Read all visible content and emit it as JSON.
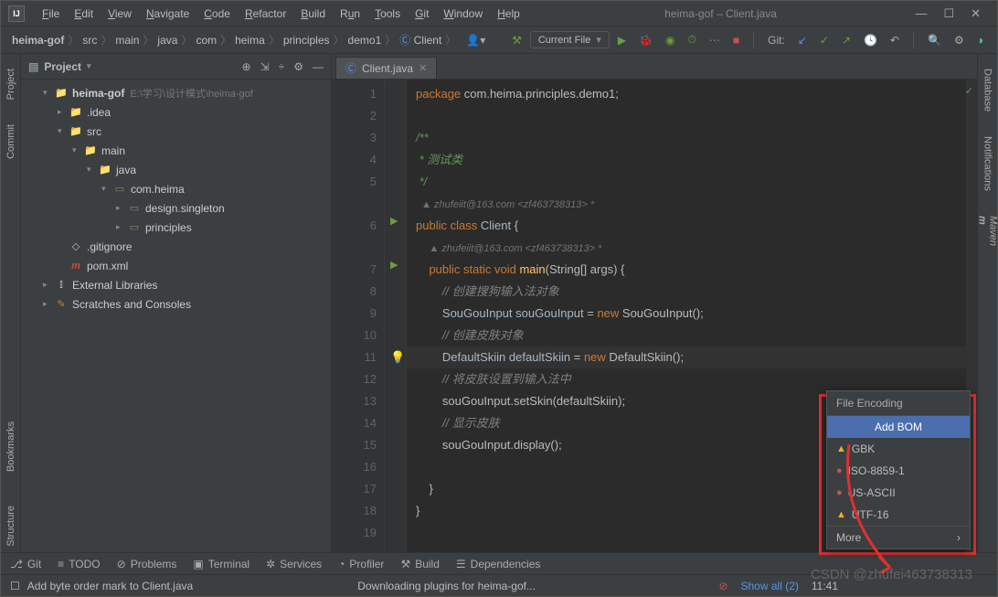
{
  "window_title": "heima-gof – Client.java",
  "menu": [
    "File",
    "Edit",
    "View",
    "Navigate",
    "Code",
    "Refactor",
    "Build",
    "Run",
    "Tools",
    "Git",
    "Window",
    "Help"
  ],
  "breadcrumbs": [
    "heima-gof",
    "src",
    "main",
    "java",
    "com",
    "heima",
    "principles",
    "demo1",
    "Client"
  ],
  "breadcrumb_last_icon": "class-icon",
  "run_config_label": "Current File",
  "git_label": "Git:",
  "project": {
    "panel_title": "Project",
    "root": {
      "name": "heima-gof",
      "path": "E:\\学习\\设计模式\\heima-gof"
    },
    "nodes": [
      {
        "depth": 1,
        "expand": "v",
        "icon": "folder",
        "label": "heima-gof",
        "path": "E:\\学习\\设计模式\\heima-gof",
        "bold": true
      },
      {
        "depth": 2,
        "expand": ">",
        "icon": "folder",
        "label": ".idea"
      },
      {
        "depth": 2,
        "expand": "v",
        "icon": "folder-blue",
        "label": "src"
      },
      {
        "depth": 3,
        "expand": "v",
        "icon": "folder-blue",
        "label": "main"
      },
      {
        "depth": 4,
        "expand": "v",
        "icon": "folder-blue",
        "label": "java"
      },
      {
        "depth": 5,
        "expand": "v",
        "icon": "pkg",
        "label": "com.heima"
      },
      {
        "depth": 6,
        "expand": ">",
        "icon": "pkg",
        "label": "design.singleton"
      },
      {
        "depth": 6,
        "expand": ">",
        "icon": "pkg",
        "label": "principles"
      },
      {
        "depth": 2,
        "expand": "",
        "icon": "file",
        "label": ".gitignore"
      },
      {
        "depth": 2,
        "expand": "",
        "icon": "maven",
        "label": "pom.xml"
      },
      {
        "depth": 1,
        "expand": ">",
        "icon": "lib",
        "label": "External Libraries"
      },
      {
        "depth": 1,
        "expand": ">",
        "icon": "scratch",
        "label": "Scratches and Consoles"
      }
    ]
  },
  "editor": {
    "tab_name": "Client.java",
    "lines": [
      {
        "n": 1,
        "html": "<span class='kw'>package</span> com.heima.principles.demo1;"
      },
      {
        "n": 2,
        "html": ""
      },
      {
        "n": 3,
        "html": "<span class='doc'>/**</span>"
      },
      {
        "n": 4,
        "html": "<span class='doc'> * 测试类</span>"
      },
      {
        "n": 5,
        "html": "<span class='doc'> */</span>"
      },
      {
        "n": "",
        "html": "<span class='author'>  ▲ zhufeiit@163.com &lt;zf463738313&gt; *</span>"
      },
      {
        "n": 6,
        "run": true,
        "html": "<span class='kw'>public class</span> <span class='cls'>Client</span> {"
      },
      {
        "n": "",
        "html": "    <span class='author'>▲ zhufeiit@163.com &lt;zf463738313&gt; *</span>"
      },
      {
        "n": 7,
        "run": true,
        "html": "    <span class='kw'>public static void</span> <span class='fn'>main</span>(String[] args) {"
      },
      {
        "n": 8,
        "html": "        <span class='com'>// 创建搜狗输入法对象</span>"
      },
      {
        "n": 9,
        "html": "        <span class='cls'>SouGouInput</span> <span class='var'>souGouInput</span> = <span class='kw'>new</span> SouGouInput();"
      },
      {
        "n": 10,
        "html": "        <span class='com'>// 创建皮肤对象</span>"
      },
      {
        "n": 11,
        "hl": true,
        "bulb": true,
        "html": "        <span class='cls'>DefaultSkiin</span> <span class='var'>defaultSkiin</span> = <span class='kw'>new</span> DefaultSkiin();"
      },
      {
        "n": 12,
        "html": "        <span class='com'>// 将皮肤设置到输入法中</span>"
      },
      {
        "n": 13,
        "html": "        souGouInput.setSkin(defaultSkiin);"
      },
      {
        "n": 14,
        "html": "        <span class='com'>// 显示皮肤</span>"
      },
      {
        "n": 15,
        "html": "        souGouInput.display();"
      },
      {
        "n": 16,
        "html": ""
      },
      {
        "n": 17,
        "html": "    }"
      },
      {
        "n": 18,
        "html": "}"
      },
      {
        "n": 19,
        "html": ""
      }
    ]
  },
  "encoding_popup": {
    "title": "File Encoding",
    "add_bom": "Add BOM",
    "items": [
      {
        "icon": "warn",
        "label": "GBK"
      },
      {
        "icon": "err",
        "label": "ISO-8859-1"
      },
      {
        "icon": "err",
        "label": "US-ASCII"
      },
      {
        "icon": "warn",
        "label": "UTF-16"
      }
    ],
    "more": "More"
  },
  "tool_windows": [
    "Git",
    "TODO",
    "Problems",
    "Terminal",
    "Services",
    "Profiler",
    "Build",
    "Dependencies"
  ],
  "left_tabs": [
    "Project",
    "Commit",
    "Bookmarks",
    "Structure"
  ],
  "right_tabs": [
    "Database",
    "Notifications",
    "Maven"
  ],
  "status": {
    "left_text": "Add byte order mark to Client.java",
    "center_text": "Downloading plugins for heima-gof...",
    "show_all": "Show all (2)",
    "time": "11:41",
    "encoding": "CSDN @zhufei463738313"
  },
  "watermark": "CSDN @zhufei463738313"
}
